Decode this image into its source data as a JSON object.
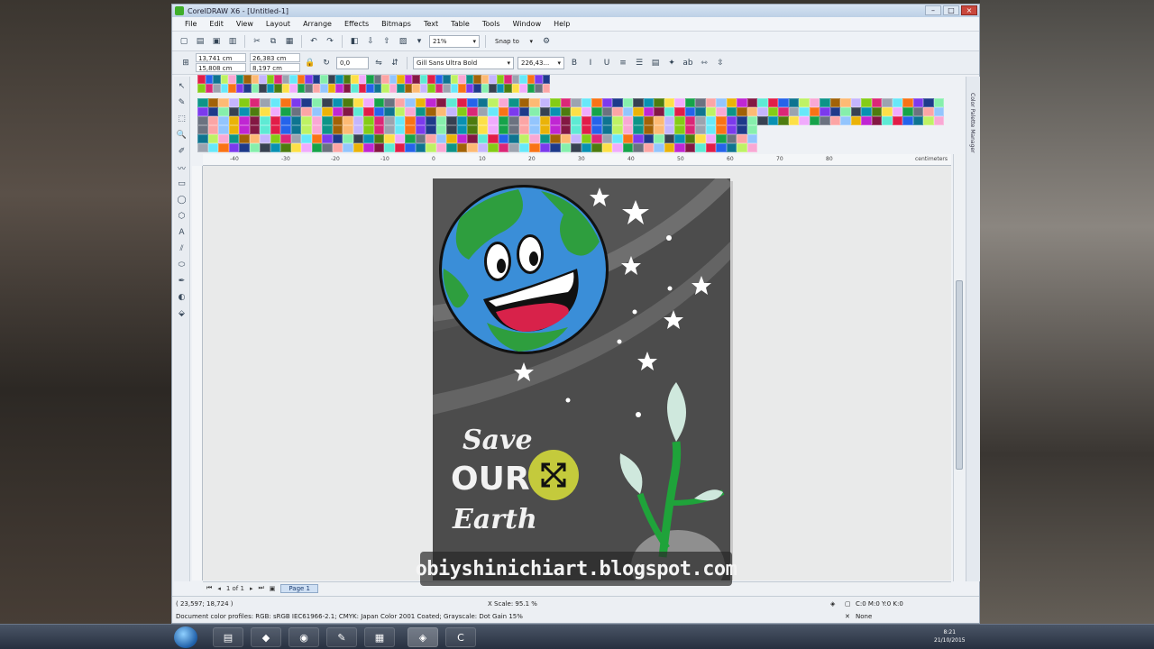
{
  "window": {
    "title": "CorelDRAW X6 - [Untitled-1]",
    "controls": [
      "–",
      "□",
      "×"
    ]
  },
  "menu": [
    "File",
    "Edit",
    "View",
    "Layout",
    "Arrange",
    "Effects",
    "Bitmaps",
    "Text",
    "Table",
    "Tools",
    "Window",
    "Help"
  ],
  "toolbar": {
    "zoom": "21%",
    "snap_to": "Snap to"
  },
  "propbar": {
    "x": "13,741 cm",
    "y": "15,808 cm",
    "w": "26,383 cm",
    "h": "8,197 cm",
    "angle": "0,0",
    "font": "Gill Sans Ultra Bold",
    "font_size": "226,43..."
  },
  "tools": [
    "↖",
    "✎",
    "⬚",
    "🔍",
    "✐",
    "〰",
    "▭",
    "◯",
    "⬡",
    "A",
    "⫽",
    "⬭",
    "✒",
    "◐",
    "⬙"
  ],
  "rulers": {
    "top_labels": [
      "-40",
      "-30",
      "-20",
      "-10",
      "0",
      "10",
      "20",
      "30",
      "40",
      "50",
      "60",
      "70",
      "80"
    ],
    "unit": "centimeters"
  },
  "poster": {
    "title_line1": "Save",
    "title_line2": "OUR",
    "title_line3": "Earth"
  },
  "dock": {
    "label": "Color Palette Manager"
  },
  "pagebar": {
    "page_count": "1 of 1",
    "page_tab": "Page 1"
  },
  "status": {
    "cursor": "( 23,597; 18,724 )",
    "scale": "X Scale: 95.1 %",
    "profiles": "Document color profiles: RGB: sRGB IEC61966-2.1; CMYK: Japan Color 2001 Coated; Grayscale: Dot Gain 15%",
    "fill": "C:0 M:0 Y:0 K:0",
    "outline": "None"
  },
  "taskbar": {
    "time": "8:21",
    "date": "21/10/2015"
  },
  "watermark": "obiyshinichiart.blogspot.com",
  "colors": {
    "poster_bg": "#4c4c4c",
    "ocean": "#3a8ed8",
    "land": "#2e9e3e",
    "mouth": "#d8224a",
    "plant": "#1fa33a",
    "highlight": "#d9e03a"
  }
}
